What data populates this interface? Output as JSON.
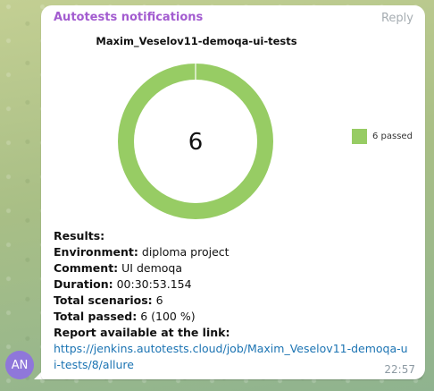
{
  "message": {
    "sender": "Autotests notifications",
    "reply_label": "Reply",
    "time": "22:57",
    "avatar_initials": "AN"
  },
  "chart_data": {
    "type": "pie",
    "title": "Maxim_Veselov11-demoqa-ui-tests",
    "center_label": "6",
    "categories": [
      "passed"
    ],
    "values": [
      6
    ],
    "legend": [
      {
        "label": "6 passed",
        "color": "#97cc64"
      }
    ],
    "legend_position": "right",
    "donut": true
  },
  "report": {
    "results_label": "Results:",
    "environment_label": "Environment:",
    "environment_value": "diploma project",
    "comment_label": "Comment:",
    "comment_value": "UI demoqa",
    "duration_label": "Duration:",
    "duration_value": "00:30:53.154",
    "total_scenarios_label": "Total scenarios:",
    "total_scenarios_value": "6",
    "total_passed_label": "Total passed:",
    "total_passed_value": "6 (100 %)",
    "report_link_label": "Report available at the link:",
    "report_link": "https://jenkins.autotests.cloud/job/Maxim_Veselov11-demoqa-ui-tests/8/allure"
  }
}
